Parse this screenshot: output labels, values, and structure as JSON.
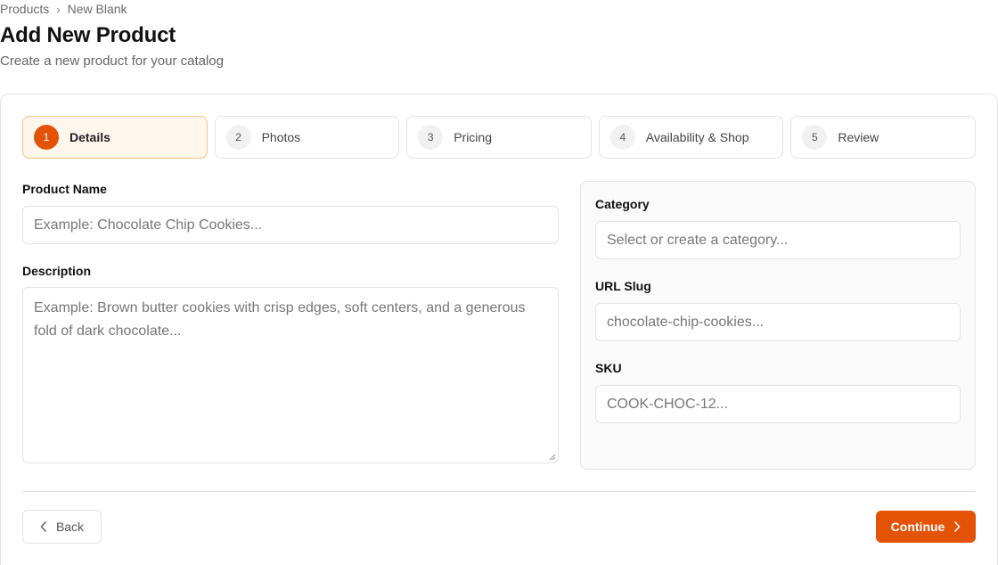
{
  "breadcrumb": {
    "items": [
      "Products",
      "New Blank"
    ],
    "separator": "›"
  },
  "header": {
    "title": "Add New Product",
    "subtitle": "Create a new product for your catalog"
  },
  "steps": [
    {
      "number": "1",
      "label": "Details",
      "active": true
    },
    {
      "number": "2",
      "label": "Photos",
      "active": false
    },
    {
      "number": "3",
      "label": "Pricing",
      "active": false
    },
    {
      "number": "4",
      "label": "Availability & Shop",
      "active": false
    },
    {
      "number": "5",
      "label": "Review",
      "active": false
    }
  ],
  "form": {
    "product_name": {
      "label": "Product Name",
      "value": "",
      "placeholder": "Example: Chocolate Chip Cookies..."
    },
    "description": {
      "label": "Description",
      "value": "",
      "placeholder": "Example: Brown butter cookies with crisp edges, soft centers, and a generous fold of dark chocolate..."
    },
    "category": {
      "label": "Category",
      "value": "",
      "placeholder": "Select or create a category..."
    },
    "url_slug": {
      "label": "URL Slug",
      "value": "",
      "placeholder": "chocolate-chip-cookies..."
    },
    "sku": {
      "label": "SKU",
      "value": "",
      "placeholder": "COOK-CHOC-12..."
    }
  },
  "footer": {
    "back_label": "Back",
    "continue_label": "Continue"
  },
  "icons": {
    "back": "chevron-left-icon",
    "continue": "chevron-right-icon",
    "resize": "resize-handle-icon"
  },
  "colors": {
    "accent": "#e35205",
    "active_step_bg": "#fff6ec",
    "active_step_border": "#f5c28a",
    "border": "#e4e4e7",
    "panel_bg": "#fafafa"
  }
}
